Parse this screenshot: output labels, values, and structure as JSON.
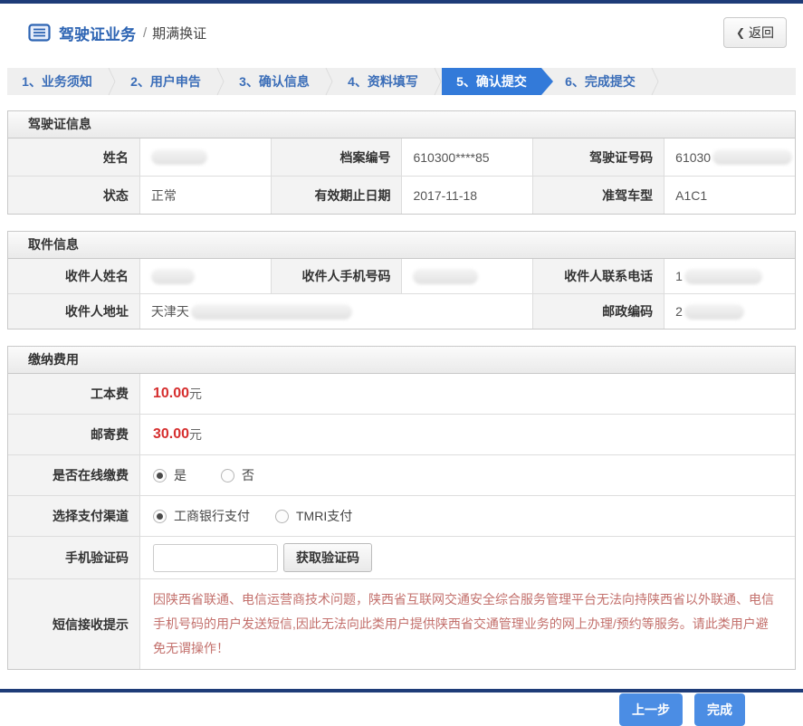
{
  "page": {
    "top_title": "驾驶证业务",
    "separator": "/",
    "page_name": "期满换证",
    "back_chevron": "❮",
    "back_button_label": "返回"
  },
  "steps": [
    {
      "label": "1、业务须知",
      "active": false
    },
    {
      "label": "2、用户申告",
      "active": false
    },
    {
      "label": "3、确认信息",
      "active": false
    },
    {
      "label": "4、资料填写",
      "active": false
    },
    {
      "label": "5、确认提交",
      "active": true
    },
    {
      "label": "6、完成提交",
      "active": false
    }
  ],
  "license_section": {
    "title": "驾驶证信息",
    "row1": {
      "name_label": "姓名",
      "name_value": "",
      "file_no_label": "档案编号",
      "file_no_value": "610300****85",
      "license_no_label": "驾驶证号码",
      "license_no_value": "61030"
    },
    "row2": {
      "status_label": "状态",
      "status_value": "正常",
      "expiry_label": "有效期止日期",
      "expiry_value": "2017-11-18",
      "vehicle_class_label": "准驾车型",
      "vehicle_class_value": "A1C1"
    }
  },
  "pickup_section": {
    "title": "取件信息",
    "row1": {
      "recipient_name_label": "收件人姓名",
      "recipient_name_value": "",
      "recipient_mobile_label": "收件人手机号码",
      "recipient_mobile_value": "",
      "recipient_phone_label": "收件人联系电话",
      "recipient_phone_value": "1"
    },
    "row2": {
      "address_label": "收件人地址",
      "address_value": "天津天",
      "zip_label": "邮政编码",
      "zip_value": "2"
    }
  },
  "payment_section": {
    "title": "缴纳费用",
    "production_fee": {
      "label": "工本费",
      "amount": "10.00",
      "unit": "元"
    },
    "postage_fee": {
      "label": "邮寄费",
      "amount": "30.00",
      "unit": "元"
    },
    "online_payment": {
      "label": "是否在线缴费",
      "options": [
        {
          "label": "是",
          "selected": true
        },
        {
          "label": "否",
          "selected": false
        }
      ]
    },
    "payment_channel": {
      "label": "选择支付渠道",
      "options": [
        {
          "label": "工商银行支付",
          "selected": true
        },
        {
          "label": "TMRI支付",
          "selected": false
        }
      ]
    },
    "sms_code": {
      "label": "手机验证码",
      "value": "",
      "button_label": "获取验证码"
    },
    "sms_notice": {
      "label": "短信接收提示",
      "text": "因陕西省联通、电信运营商技术问题，陕西省互联网交通安全综合服务管理平台无法向持陕西省以外联通、电信手机号码的用户发送短信,因此无法向此类用户提供陕西省交通管理业务的网上办理/预约等服务。请此类用户避免无谓操作！"
    }
  },
  "footer": {
    "previous_button": "上一步",
    "finish_button": "完成"
  },
  "colors": {
    "navy": "#1e3c78",
    "title_blue": "#2d64b3",
    "active_tab_blue": "#337ad9",
    "price_red": "#d62e2e",
    "notice_red": "#c3706c",
    "button_blue": "#4b8de4"
  }
}
